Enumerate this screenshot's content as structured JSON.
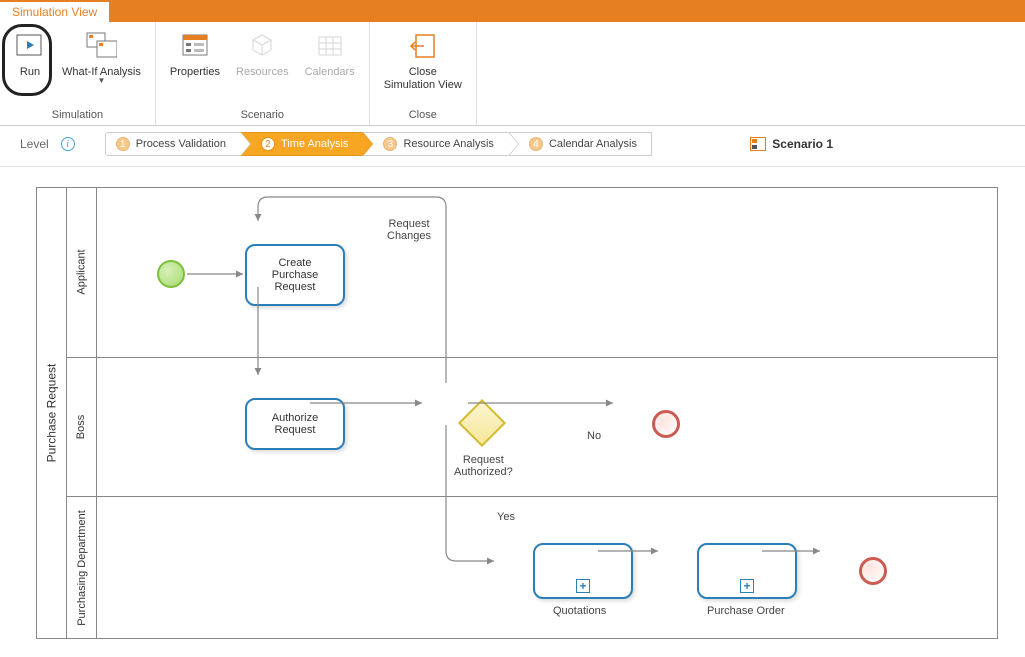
{
  "tab": {
    "label": "Simulation View"
  },
  "ribbon": {
    "groups": {
      "simulation": {
        "label": "Simulation",
        "run": "Run",
        "whatif": "What-If Analysis"
      },
      "scenario": {
        "label": "Scenario",
        "properties": "Properties",
        "resources": "Resources",
        "calendars": "Calendars"
      },
      "close": {
        "label": "Close",
        "close_sim": "Close\nSimulation View"
      }
    }
  },
  "levelbar": {
    "level": "Level",
    "steps": [
      {
        "num": "1",
        "label": "Process Validation"
      },
      {
        "num": "2",
        "label": "Time Analysis"
      },
      {
        "num": "3",
        "label": "Resource Analysis"
      },
      {
        "num": "4",
        "label": "Calendar Analysis"
      }
    ],
    "scenario": "Scenario 1"
  },
  "diagram": {
    "pool": "Purchase Request",
    "lanes": [
      "Applicant",
      "Boss",
      "Purchasing Department"
    ],
    "tasks": {
      "create": "Create\nPurchase\nRequest",
      "authorize": "Authorize\nRequest",
      "quotations": "Quotations",
      "purchase_order": "Purchase Order"
    },
    "labels": {
      "request_changes": "Request\nChanges",
      "request_authorized": "Request\nAuthorized?",
      "yes": "Yes",
      "no": "No"
    }
  }
}
